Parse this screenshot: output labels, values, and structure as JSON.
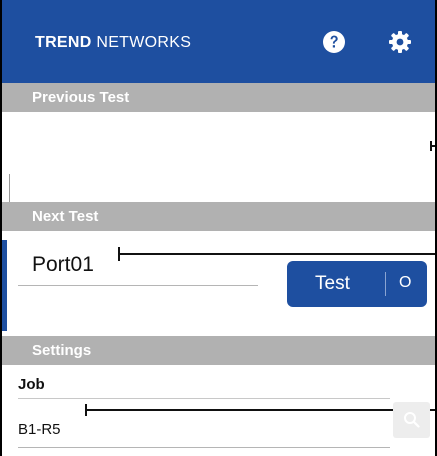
{
  "header": {
    "brand_bold": "TREND",
    "brand_rest": " NETWORKS",
    "background": "#1e4fa0",
    "icons": [
      "help-icon",
      "gear-icon"
    ]
  },
  "previous_test": {
    "label": "Previous Test"
  },
  "next_test": {
    "label": "Next Test",
    "port_value": "Port01",
    "test_button_label": "Test",
    "test_button_counter": "O"
  },
  "settings": {
    "label": "Settings",
    "job_label": "Job",
    "job_value": "B1-R5",
    "search_icon": "search-icon"
  },
  "colors": {
    "accent": "#1e4fa0",
    "section_bar": "#b1b1b1"
  }
}
